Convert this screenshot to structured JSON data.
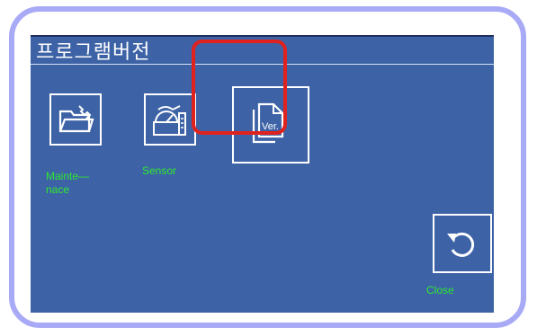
{
  "screen": {
    "title": "프로그램버전"
  },
  "menu": {
    "maintenance_label": "Mainte—\nnace",
    "sensor_label": "Sensor",
    "version_icon_text": "Ver.",
    "close_label": "Close"
  },
  "colors": {
    "screen_bg": "#3d63a6",
    "label_green": "#2fe82f",
    "highlight_red": "#e0221f",
    "frame_lavender": "#a9aaf6"
  },
  "icons": {
    "maintenance": "folder-wrench-icon",
    "sensor": "sensor-gauge-icon",
    "version": "version-document-icon",
    "close": "undo-arrow-icon"
  }
}
